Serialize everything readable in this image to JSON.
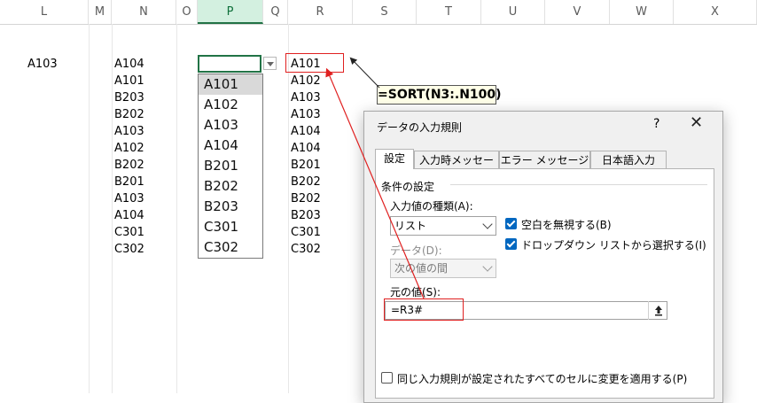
{
  "columns": [
    "L",
    "M",
    "N",
    "O",
    "P",
    "Q",
    "R",
    "S",
    "T",
    "U",
    "V",
    "W",
    "X"
  ],
  "selected_column": "P",
  "cells": {
    "L_row3": "A103",
    "N_values": [
      "A104",
      "A101",
      "B203",
      "B202",
      "A103",
      "A102",
      "B202",
      "B201",
      "A103",
      "A104",
      "C301",
      "C302"
    ],
    "R_values": [
      "A101",
      "A102",
      "A103",
      "A103",
      "A104",
      "A104",
      "B201",
      "B202",
      "B202",
      "B203",
      "C301",
      "C302"
    ]
  },
  "dropdown": {
    "items": [
      "A101",
      "A102",
      "A103",
      "A104",
      "B201",
      "B202",
      "B203",
      "C301",
      "C302"
    ],
    "highlighted_index": 0
  },
  "callout_formula": "=SORT(N3:.N100)",
  "dialog": {
    "title": "データの入力規則",
    "help": "?",
    "close": "✕",
    "tabs": [
      "設定",
      "入力時メッセージ",
      "エラー メッセージ",
      "日本語入力"
    ],
    "active_tab": 0,
    "section_title": "条件の設定",
    "allow_label": "入力値の種類(A):",
    "allow_value": "リスト",
    "ignore_blank": "空白を無視する(B)",
    "ignore_blank_checked": true,
    "dropdown_option": "ドロップダウン リストから選択する(I)",
    "dropdown_option_checked": true,
    "data_label": "データ(D):",
    "data_value": "次の値の間",
    "source_label": "元の値(S):",
    "source_value": "=R3#",
    "apply_all": "同じ入力規則が設定されたすべてのセルに変更を適用する(P)",
    "apply_all_checked": false
  },
  "colors": {
    "selected_col_bg": "#d3f0e0",
    "excel_green": "#217346",
    "annotation_red": "#e02020",
    "checkbox_blue": "#0067c0",
    "callout_bg": "#ffffe8"
  }
}
